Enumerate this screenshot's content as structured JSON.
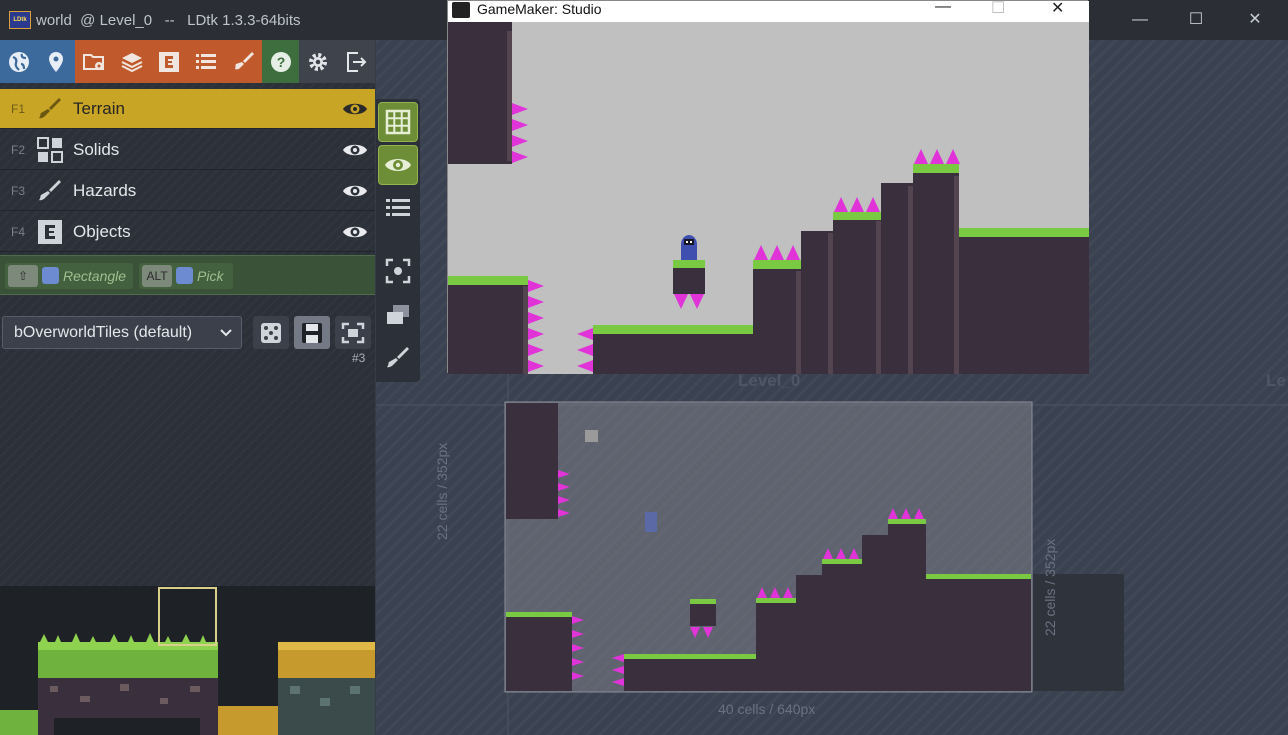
{
  "window": {
    "title": "world  @ Level_0   --   LDtk 1.3.3-64bits",
    "app_icon_text": "LDtk",
    "minimize": "—",
    "maximize": "☐",
    "close": "✕"
  },
  "toolbar": {
    "buttons": [
      {
        "name": "world",
        "icon": "globe-icon",
        "color": "#3c6a9c"
      },
      {
        "name": "level",
        "icon": "pin-icon",
        "color": "#3c6a9c"
      },
      {
        "name": "project",
        "icon": "folder-gear-icon",
        "color": "#c05a2c"
      },
      {
        "name": "layers",
        "icon": "layers-icon",
        "color": "#c05a2c"
      },
      {
        "name": "entities",
        "icon": "entity-icon",
        "color": "#c05a2c"
      },
      {
        "name": "enums",
        "icon": "list-icon",
        "color": "#c05a2c"
      },
      {
        "name": "tilesets",
        "icon": "brush-icon",
        "color": "#c05a2c"
      },
      {
        "name": "help",
        "icon": "help-icon",
        "color": "#3e6e3e"
      },
      {
        "name": "settings",
        "icon": "gear-icon",
        "color": "#3f434b"
      },
      {
        "name": "exit",
        "icon": "exit-icon",
        "color": "#3f434b"
      }
    ]
  },
  "layers": [
    {
      "key": "F1",
      "name": "Terrain",
      "icon": "brush-icon",
      "active": true
    },
    {
      "key": "F2",
      "name": "Solids",
      "icon": "grid-icon",
      "active": false
    },
    {
      "key": "F3",
      "name": "Hazards",
      "icon": "brush-icon",
      "active": false
    },
    {
      "key": "F4",
      "name": "Objects",
      "icon": "entity-icon",
      "active": false
    }
  ],
  "hints": [
    {
      "key": "⇧",
      "text": "Rectangle"
    },
    {
      "key": "ALT",
      "text": "Pick"
    }
  ],
  "tileset": {
    "selected": "bOverworldTiles (default)",
    "id_label": "#3"
  },
  "canvas": {
    "level_name": "Level_0",
    "next_level_name": "Le",
    "height_label": "22 cells / 352px",
    "width_label": "40 cells / 640px"
  },
  "game_window": {
    "title": "GameMaker: Studio",
    "minimize": "—",
    "maximize": "☐",
    "close": "✕"
  },
  "colors": {
    "accent_active_layer": "#c9a526",
    "grass": "#7ac943",
    "dirt": "#3a2f3d",
    "spike": "#e033d8",
    "sky": "#c0c0c0"
  }
}
